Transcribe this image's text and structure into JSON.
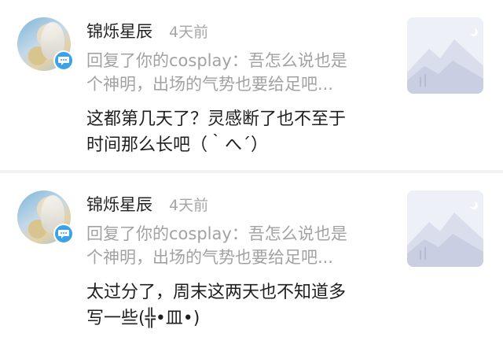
{
  "comments": [
    {
      "username": "锦烁星辰",
      "time": "4天前",
      "quote_line1": "回复了你的cosplay：吾怎么说也是",
      "quote_line2": "个神明，出场的气势也要给足吧...",
      "body_line1": "这都第几天了？灵感断了也不至于",
      "body_line2": "时间那么长吧（｀へ´）",
      "avatar_icon": "avatar-character",
      "badge_icon": "chat-bubble-icon",
      "thumbnail_icon": "image-placeholder-icon"
    },
    {
      "username": "锦烁星辰",
      "time": "4天前",
      "quote_line1": "回复了你的cosplay：吾怎么说也是",
      "quote_line2": "个神明，出场的气势也要给足吧...",
      "body_line1": "太过分了，周末这两天也不知道多",
      "body_line2": "写一些(╬•皿•)",
      "avatar_icon": "avatar-character",
      "badge_icon": "chat-bubble-icon",
      "thumbnail_icon": "image-placeholder-icon"
    }
  ],
  "colors": {
    "badge": "#3aa3e8",
    "muted_text": "#a2a2a2",
    "separator": "#f3f3f3",
    "thumbnail_bg": "#eef0f8"
  }
}
